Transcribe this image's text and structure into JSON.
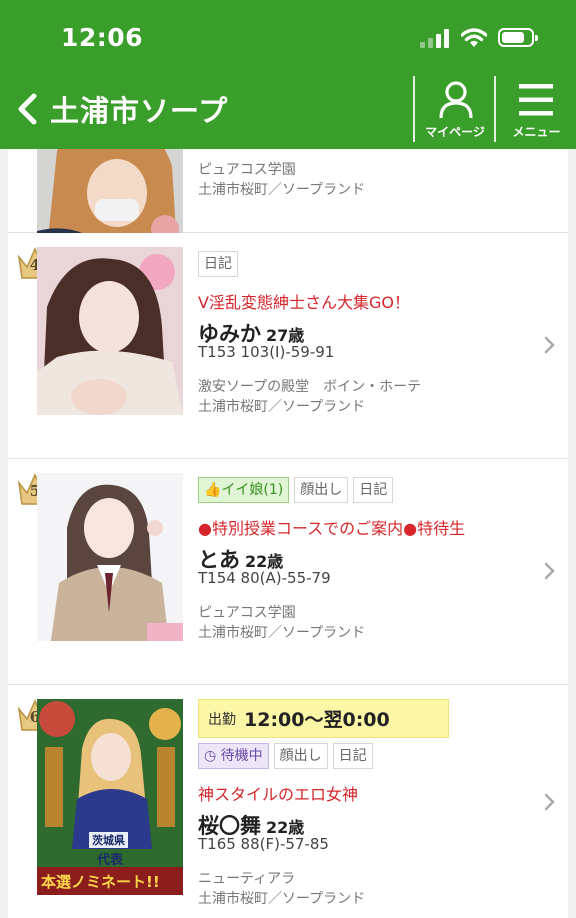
{
  "status_bar": {
    "time": "12:06"
  },
  "nav": {
    "title": "土浦市ソープ",
    "mypage_label": "マイページ",
    "menu_label": "メニュー"
  },
  "cards": [
    {
      "shop": "ピュアコス学園",
      "area": "土浦市桜町／ソープランド"
    },
    {
      "rank": "4",
      "tags": [
        "日記"
      ],
      "catch": "V淫乱変態紳士さん大集GO！",
      "name": "ゆみか",
      "age": "27歳",
      "spec": "T153 103(I)-59-91",
      "shop": "激安ソープの殿堂　ボイン・ホーテ",
      "area": "土浦市桜町／ソープランド"
    },
    {
      "rank": "5",
      "tags": [
        "イイ娘(1)",
        "顔出し",
        "日記"
      ],
      "catch": "●特別授業コースでのご案内●特待生",
      "name": "とあ",
      "age": "22歳",
      "spec": "T154 80(A)-55-79",
      "shop": "ピュアコス学園",
      "area": "土浦市桜町／ソープランド"
    },
    {
      "rank": "6",
      "shift_label": "出勤",
      "shift_time": "12:00〜翌0:00",
      "tags": [
        "待機中",
        "顔出し",
        "日記"
      ],
      "catch": "神スタイルのエロ女神",
      "name": "桜〇舞",
      "age": "22歳",
      "spec": "T165 88(F)-57-85",
      "shop": "ニューティアラ",
      "area": "土浦市桜町／ソープランド",
      "photo_text": [
        "茨城県",
        "代表",
        "本選ノミネート!!"
      ]
    }
  ],
  "colors": {
    "header_green": "#3a9e2a",
    "catch_red": "#d6262b",
    "shift_yellow": "#fcf7a6"
  }
}
